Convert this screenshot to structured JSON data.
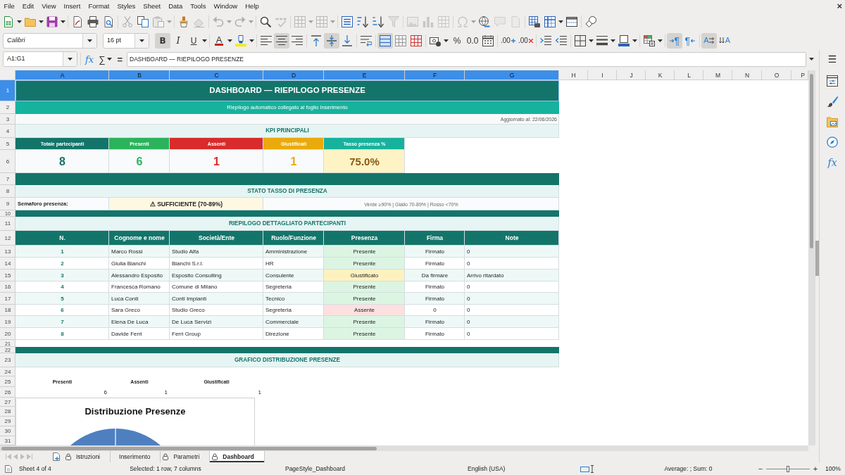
{
  "menu_bar": [
    "File",
    "Edit",
    "View",
    "Insert",
    "Format",
    "Styles",
    "Sheet",
    "Data",
    "Tools",
    "Window",
    "Help"
  ],
  "window_close": "×",
  "standard_toolbar": [
    [
      {
        "kind": "new",
        "dropdown": true,
        "disabled": false
      },
      {
        "kind": "open",
        "dropdown": true,
        "disabled": false
      },
      {
        "kind": "save",
        "dropdown": true,
        "disabled": false
      }
    ],
    [
      {
        "kind": "export_pdf",
        "disabled": false
      },
      {
        "kind": "print",
        "disabled": false
      },
      {
        "kind": "print_preview",
        "disabled": false
      }
    ],
    [
      {
        "kind": "cut",
        "disabled": true
      },
      {
        "kind": "copy",
        "disabled": false
      },
      {
        "kind": "paste",
        "dropdown": true,
        "disabled": true
      }
    ],
    [
      {
        "kind": "clone_format",
        "disabled": false
      },
      {
        "kind": "clear_format",
        "disabled": true
      }
    ],
    [
      {
        "kind": "undo",
        "dropdown": true,
        "disabled": true
      },
      {
        "kind": "redo",
        "dropdown": true,
        "disabled": true
      }
    ],
    [
      {
        "kind": "find_replace",
        "disabled": false
      },
      {
        "kind": "spelling",
        "disabled": true
      }
    ],
    [
      {
        "kind": "row",
        "dropdown": true,
        "disabled": true
      },
      {
        "kind": "column",
        "dropdown": true,
        "disabled": true
      }
    ],
    [
      {
        "kind": "sort",
        "disabled": false
      },
      {
        "kind": "sort_ascending",
        "disabled": false
      },
      {
        "kind": "sort_descending",
        "disabled": false
      },
      {
        "kind": "autofilter",
        "disabled": true
      }
    ],
    [
      {
        "kind": "image",
        "disabled": true
      },
      {
        "kind": "chart",
        "disabled": true
      },
      {
        "kind": "pivot",
        "disabled": true
      }
    ],
    [
      {
        "kind": "special_character",
        "dropdown": true,
        "disabled": true
      },
      {
        "kind": "hyperlink",
        "disabled": false
      },
      {
        "kind": "comment",
        "disabled": true
      },
      {
        "kind": "header_footer",
        "disabled": true
      }
    ],
    [
      {
        "kind": "print_area",
        "disabled": false
      },
      {
        "kind": "freeze",
        "dropdown": true,
        "disabled": false
      },
      {
        "kind": "split",
        "disabled": false
      }
    ],
    [
      {
        "kind": "shapes",
        "disabled": false
      }
    ]
  ],
  "format_toolbar": {
    "font_name": "Calibri",
    "font_size": "16 pt",
    "groups": [
      [
        {
          "kind": "bold",
          "label": "B",
          "pressed": true
        },
        {
          "kind": "italic",
          "label": "I",
          "pressed": false
        },
        {
          "kind": "underline",
          "label": "U",
          "pressed": false,
          "dropdown": true
        }
      ],
      [
        {
          "kind": "font_color",
          "label": "A",
          "pressed": false,
          "dropdown": true
        },
        {
          "kind": "highlight",
          "pressed": false,
          "dropdown": true
        }
      ],
      [
        {
          "kind": "align_left",
          "pressed": false
        },
        {
          "kind": "align_center",
          "pressed": true
        },
        {
          "kind": "align_right",
          "pressed": false
        }
      ],
      [
        {
          "kind": "align_top",
          "pressed": false
        },
        {
          "kind": "align_middle",
          "pressed": true
        },
        {
          "kind": "align_bottom",
          "pressed": false
        }
      ],
      [
        {
          "kind": "wrap",
          "pressed": false
        }
      ],
      [
        {
          "kind": "merge_center",
          "pressed": true
        },
        {
          "kind": "merge",
          "pressed": false
        },
        {
          "kind": "unmerge",
          "pressed": false
        }
      ],
      [
        {
          "kind": "currency",
          "pressed": false,
          "dropdown": true
        },
        {
          "kind": "percent",
          "label": "%",
          "pressed": false
        },
        {
          "kind": "number",
          "label": "0.0",
          "pressed": false
        },
        {
          "kind": "date",
          "pressed": false
        }
      ],
      [
        {
          "kind": "add_decimal",
          "label": ".00",
          "pressed": false
        },
        {
          "kind": "delete_decimal",
          "label": ".00",
          "pressed": false
        }
      ],
      [
        {
          "kind": "indent_more",
          "pressed": false
        },
        {
          "kind": "indent_less",
          "pressed": false
        }
      ],
      [
        {
          "kind": "borders",
          "pressed": false,
          "dropdown": true
        },
        {
          "kind": "border_style",
          "pressed": false,
          "dropdown": true
        },
        {
          "kind": "border_color",
          "pressed": false,
          "dropdown": true
        }
      ],
      [
        {
          "kind": "conditional",
          "pressed": false,
          "dropdown": true
        }
      ],
      [
        {
          "kind": "ltr",
          "label": "¶",
          "pressed": true
        },
        {
          "kind": "rtl",
          "label": "¶",
          "pressed": false
        }
      ],
      [
        {
          "kind": "text_horizontal",
          "label": "A",
          "pressed": true
        },
        {
          "kind": "text_vertical",
          "label": "A",
          "pressed": false
        }
      ]
    ]
  },
  "formula_bar": {
    "name_box": "A1:G1",
    "function_wizard": "fx",
    "sum": "∑",
    "equals": "=",
    "content": "DASHBOARD — RIEPILOGO PRESENZE"
  },
  "sidebar": {
    "menu": "☰",
    "functions": "fx"
  },
  "sheet": {
    "columns": [
      {
        "label": "A",
        "selected": true
      },
      {
        "label": "B",
        "selected": true
      },
      {
        "label": "C",
        "selected": true
      },
      {
        "label": "D",
        "selected": true
      },
      {
        "label": "E",
        "selected": true
      },
      {
        "label": "F",
        "selected": true
      },
      {
        "label": "G",
        "selected": true
      },
      {
        "label": "H",
        "selected": false
      },
      {
        "label": "I",
        "selected": false
      },
      {
        "label": "J",
        "selected": false
      },
      {
        "label": "K",
        "selected": false
      },
      {
        "label": "L",
        "selected": false
      },
      {
        "label": "M",
        "selected": false
      },
      {
        "label": "N",
        "selected": false
      },
      {
        "label": "O",
        "selected": false
      },
      {
        "label": "P",
        "selected": false
      }
    ],
    "rows": [
      {
        "label": "1",
        "selected": true
      },
      {
        "label": "2",
        "selected": false
      },
      {
        "label": "3",
        "selected": false
      },
      {
        "label": "4",
        "selected": false
      },
      {
        "label": "5",
        "selected": false
      },
      {
        "label": "6",
        "selected": false
      },
      {
        "label": "7",
        "selected": false
      },
      {
        "label": "8",
        "selected": false
      },
      {
        "label": "9",
        "selected": false
      },
      {
        "label": "10",
        "selected": false
      },
      {
        "label": "11",
        "selected": false
      },
      {
        "label": "12",
        "selected": false
      },
      {
        "label": "13",
        "selected": false
      },
      {
        "label": "14",
        "selected": false
      },
      {
        "label": "15",
        "selected": false
      },
      {
        "label": "16",
        "selected": false
      },
      {
        "label": "17",
        "selected": false
      },
      {
        "label": "18",
        "selected": false
      },
      {
        "label": "19",
        "selected": false
      },
      {
        "label": "20",
        "selected": false
      },
      {
        "label": "21",
        "selected": false
      },
      {
        "label": "22",
        "selected": false
      },
      {
        "label": "23",
        "selected": false
      },
      {
        "label": "24",
        "selected": false
      },
      {
        "label": "25",
        "selected": false
      },
      {
        "label": "26",
        "selected": false
      },
      {
        "label": "27",
        "selected": false
      },
      {
        "label": "28",
        "selected": false
      },
      {
        "label": "29",
        "selected": false
      },
      {
        "label": "30",
        "selected": false
      },
      {
        "label": "31",
        "selected": false
      }
    ],
    "title": "DASHBOARD — RIEPILOGO PRESENZE",
    "subtitle": "Riepilogo automatico collegato al foglio Inserimento",
    "updated": "Aggiornato al: 22/06/2026",
    "kpi": {
      "heading": "KPI PRINCIPALI",
      "items": [
        {
          "kind": "count",
          "label": "Totale partecipanti",
          "value": "8",
          "color": "#13756a"
        },
        {
          "kind": "count",
          "label": "Presenti",
          "value": "6",
          "color": "#2bb35c"
        },
        {
          "kind": "count",
          "label": "Assenti",
          "value": "1",
          "color": "#d92b2b"
        },
        {
          "kind": "count",
          "label": "Giustificati",
          "value": "1",
          "color": "#eaaa0c"
        },
        {
          "kind": "rate",
          "label": "Tasso presenza %",
          "value": "75.0%",
          "color": "#17b29d"
        }
      ]
    },
    "status": {
      "heading": "STATO TASSO DI PRESENZA",
      "label": "Semaforo presenza:",
      "value": "⚠ SUFFICIENTE (70-89%)",
      "kind": "warning",
      "legend": "Verde ≥90% | Giallo 70-89% | Rosso <70%"
    },
    "detail": {
      "heading": "RIEPILOGO DETTAGLIATO PARTECIPANTI",
      "columns": [
        "N.",
        "Cognome e nome",
        "Società/Ente",
        "Ruolo/Funzione",
        "Presenza",
        "Firma",
        "Note"
      ],
      "rows": [
        {
          "kind": "present",
          "cells": [
            "1",
            "Marco Rossi",
            "Studio Alfa",
            "Amministrazione",
            "Presente",
            "Firmato",
            "0"
          ]
        },
        {
          "kind": "present",
          "cells": [
            "2",
            "Giulia Bianchi",
            "Bianchi S.r.l.",
            "HR",
            "Presente",
            "Firmato",
            "0"
          ]
        },
        {
          "kind": "justified",
          "cells": [
            "3",
            "Alessandro Esposito",
            "Esposito Consulting",
            "Consulente",
            "Giustificato",
            "Da firmare",
            "Arrivo ritardato"
          ]
        },
        {
          "kind": "present",
          "cells": [
            "4",
            "Francesca Romano",
            "Comune di Milano",
            "Segreteria",
            "Presente",
            "Firmato",
            "0"
          ]
        },
        {
          "kind": "present",
          "cells": [
            "5",
            "Luca Conti",
            "Conti Impianti",
            "Tecnico",
            "Presente",
            "Firmato",
            "0"
          ]
        },
        {
          "kind": "absent",
          "cells": [
            "6",
            "Sara Greco",
            "Studio Greco",
            "Segreteria",
            "Assente",
            "0",
            "0"
          ]
        },
        {
          "kind": "present",
          "cells": [
            "7",
            "Elena De Luca",
            "De Luca Servizi",
            "Commerciale",
            "Presente",
            "Firmato",
            "0"
          ]
        },
        {
          "kind": "present",
          "cells": [
            "8",
            "Davide Ferri",
            "Ferri Group",
            "Direzione",
            "Presente",
            "Firmato",
            "0"
          ]
        }
      ]
    },
    "chart_section": {
      "heading": "GRAFICO DISTRIBUZIONE PRESENZE",
      "labels": [
        "Presenti",
        "Assenti",
        "Giustificati"
      ],
      "values": [
        "6",
        "1",
        "1"
      ],
      "chart_title": "Distribuzione Presenze"
    }
  },
  "sheet_navigation": [
    {
      "kind": "first",
      "disabled": true
    },
    {
      "kind": "previous",
      "disabled": true
    },
    {
      "kind": "next",
      "disabled": true
    },
    {
      "kind": "last",
      "disabled": true
    }
  ],
  "sheet_tabs": [
    {
      "label": "Istruzioni",
      "locked": true,
      "selected": false
    },
    {
      "label": "Inserimento",
      "locked": false,
      "selected": false
    },
    {
      "label": "Parametri",
      "locked": true,
      "selected": false
    },
    {
      "label": "Dashboard",
      "locked": true,
      "selected": true
    }
  ],
  "status_bar": {
    "sheet": "Sheet 4 of 4",
    "selection": "Selected: 1 row, 7 columns",
    "page_style": "PageStyle_Dashboard",
    "language": "English (USA)",
    "summary": "Average: ; Sum: 0",
    "zoom_out": "−",
    "zoom_slider": {
      "level": 0.5
    },
    "zoom_in": "+",
    "zoom": "100%"
  }
}
